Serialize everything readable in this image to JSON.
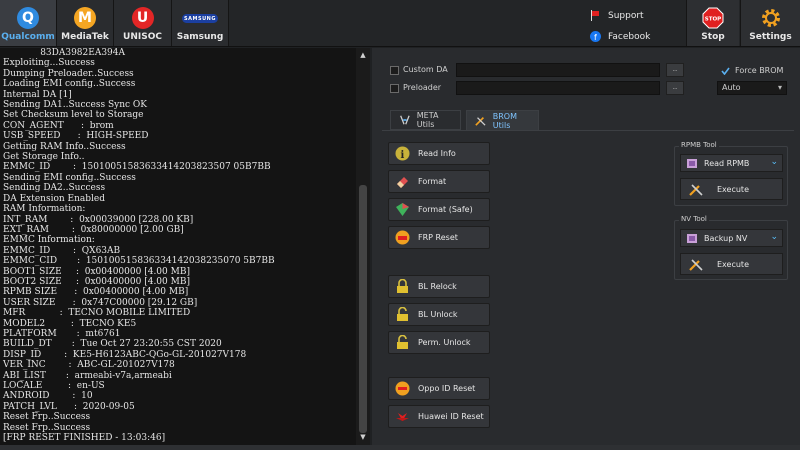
{
  "tabs": [
    {
      "label": "Qualcomm",
      "glyph": "Q"
    },
    {
      "label": "MediaTek",
      "glyph": "M"
    },
    {
      "label": "UNISOC",
      "glyph": "U"
    },
    {
      "label": "Samsung",
      "glyph": "SAMSUNG"
    }
  ],
  "links": {
    "support": "Support",
    "facebook": "Facebook"
  },
  "stop": {
    "label": "Stop",
    "glyph": "STOP"
  },
  "settings": {
    "label": "Settings"
  },
  "log": [
    "             83DA3982EA394A",
    "Exploiting...Success",
    "Dumping Preloader..Success",
    "Loading EMI config..Success",
    "Internal DA [1]",
    "Sending DA1..Success Sync OK",
    "Set Checksum level to Storage",
    "CON_AGENT      :  brom",
    "USB_SPEED      :  HIGH-SPEED",
    "Getting RAM Info..Success",
    "Get Storage Info..",
    "EMMC_ID        :  15010051583633414203823507 05B7BB",
    "Sending EMI config..Success",
    "Sending DA2..Success",
    "DA Extension Enabled",
    "RAM Information:",
    "INT_RAM        :  0x00039000 [228.00 KB]",
    "EXT_RAM        :  0x80000000 [2.00 GB]",
    "EMMC Information:",
    "EMMC_ID        :  QX63AB",
    "EMMC_CID       :  150100515836334142038235070 5B7BB",
    "BOOT1 SIZE     :  0x00400000 [4.00 MB]",
    "BOOT2 SIZE     :  0x00400000 [4.00 MB]",
    "RPMB SIZE      :  0x00400000 [4.00 MB]",
    "USER SIZE      :  0x747C00000 [29.12 GB]",
    "MFR            :  TECNO MOBILE LIMITED",
    "MODEL2         :  TECNO KE5",
    "PLATFORM       :  mt6761",
    "BUILD_DT       :  Tue Oct 27 23:20:55 CST 2020",
    "DISP_ID        :  KE5-H6123ABC-QGo-GL-201027V178",
    "VER_INC        :  ABC-GL-201027V178",
    "ABI_LIST       :  armeabi-v7a,armeabi",
    "LOCALE         :  en-US",
    "ANDROID        :  10",
    "PATCH_LVL      :  2020-09-05",
    "Reset Frp..Success",
    "Reset Frp..Success",
    "[FRP RESET FINISHED - 13:03:46]"
  ],
  "options": {
    "custom_da": "Custom DA",
    "preloader": "Preloader",
    "browse": "..",
    "force_brom": "Force BROM",
    "mode_value": "Auto"
  },
  "subtabs": {
    "meta": "META Utils",
    "brom": "BROM Utils"
  },
  "actions": {
    "read_info": "Read Info",
    "format": "Format",
    "format_safe": "Format (Safe)",
    "frp_reset": "FRP Reset",
    "bl_relock": "BL Relock",
    "bl_unlock": "BL Unlock",
    "perm_unlock": "Perm. Unlock",
    "oppo_id": "Oppo ID Reset",
    "huawei_id": "Huawei ID Reset"
  },
  "rpmb": {
    "title": "RPMB Tool",
    "selected": "Read RPMB",
    "execute": "Execute"
  },
  "nv": {
    "title": "NV Tool",
    "selected": "Backup NV",
    "execute": "Execute"
  },
  "colors": {
    "accent": "#5ab0f0",
    "stop": "#e02020"
  }
}
